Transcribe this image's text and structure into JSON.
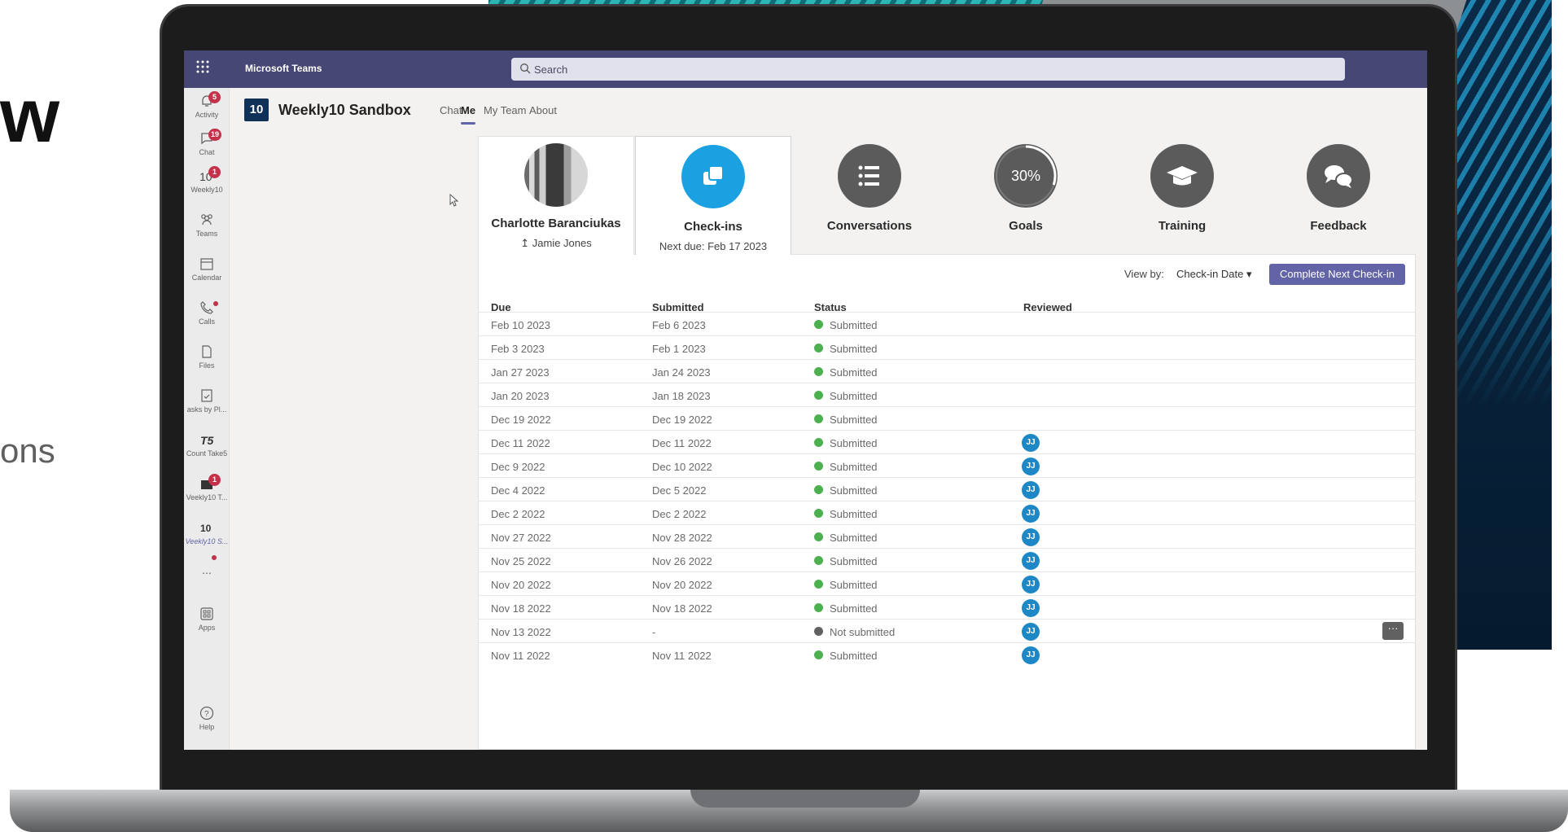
{
  "background": {
    "hero_letter": "w",
    "hero_subtext": "ons",
    "accent_dark": "#0b2b48",
    "accent_stripes": "#1f87b3"
  },
  "topbar": {
    "app_launcher_icon": "waffle-icon",
    "brand": "Microsoft Teams",
    "search_placeholder": "Search",
    "color": "#464775"
  },
  "rail": [
    {
      "label": "Activity",
      "icon": "bell-icon",
      "badge": "5"
    },
    {
      "label": "Chat",
      "icon": "chat-icon",
      "badge": "19"
    },
    {
      "label": "Weekly10",
      "icon": "weekly10-icon",
      "badge": "1"
    },
    {
      "label": "Teams",
      "icon": "teams-icon",
      "badge": ""
    },
    {
      "label": "Calendar",
      "icon": "calendar-icon",
      "badge": ""
    },
    {
      "label": "Calls",
      "icon": "phone-icon",
      "badge": ""
    },
    {
      "label": "Files",
      "icon": "file-icon",
      "badge": ""
    },
    {
      "label": "asks by Pl...",
      "icon": "tasks-icon",
      "badge": ""
    },
    {
      "label": "Count Take5",
      "icon": "take5-icon",
      "badge": ""
    },
    {
      "label": "Veekly10 T...",
      "icon": "weekly10-team-icon",
      "badge": "1"
    },
    {
      "label": "Veekly10 S...",
      "icon": "weekly10-sandbox-icon",
      "badge": ""
    },
    {
      "label": "...",
      "icon": "more-icon",
      "badge": ""
    },
    {
      "label": "Apps",
      "icon": "apps-icon",
      "badge": ""
    },
    {
      "label": "Help",
      "icon": "help-icon",
      "badge": ""
    }
  ],
  "app": {
    "logo": "10",
    "name": "Weekly10 Sandbox",
    "tabs": [
      "Chat",
      "Me",
      "My Team",
      "About"
    ],
    "active_tab": "Me"
  },
  "cards": {
    "profile": {
      "name": "Charlotte Baranciukas",
      "manager": "↥ Jamie Jones"
    },
    "checkins": {
      "title": "Check-ins",
      "sub": "Next due: Feb 17 2023",
      "color": "#1ba1e2"
    },
    "conversations": {
      "title": "Conversations",
      "color": "#5b5b5b"
    },
    "goals": {
      "title": "Goals",
      "progress_label": "30%",
      "progress": 0.3,
      "color": "#5b5b5b"
    },
    "training": {
      "title": "Training",
      "color": "#5b5b5b"
    },
    "feedback": {
      "title": "Feedback",
      "color": "#5b5b5b"
    }
  },
  "toolbar": {
    "view_by_label": "View by:",
    "view_by_value": "Check-in Date ▾",
    "cta_label": "Complete Next Check-in"
  },
  "table": {
    "headers": [
      "Due",
      "Submitted",
      "Status",
      "Reviewed"
    ],
    "rows": [
      {
        "due": "Feb 10 2023",
        "submitted": "Feb 6 2023",
        "status": "Submitted",
        "reviewed": ""
      },
      {
        "due": "Feb 3 2023",
        "submitted": "Feb 1 2023",
        "status": "Submitted",
        "reviewed": ""
      },
      {
        "due": "Jan 27 2023",
        "submitted": "Jan 24 2023",
        "status": "Submitted",
        "reviewed": ""
      },
      {
        "due": "Jan 20 2023",
        "submitted": "Jan 18 2023",
        "status": "Submitted",
        "reviewed": ""
      },
      {
        "due": "Dec 19 2022",
        "submitted": "Dec 19 2022",
        "status": "Submitted",
        "reviewed": ""
      },
      {
        "due": "Dec 11 2022",
        "submitted": "Dec 11 2022",
        "status": "Submitted",
        "reviewed": "JJ"
      },
      {
        "due": "Dec 9 2022",
        "submitted": "Dec 10 2022",
        "status": "Submitted",
        "reviewed": "JJ"
      },
      {
        "due": "Dec 4 2022",
        "submitted": "Dec 5 2022",
        "status": "Submitted",
        "reviewed": "JJ"
      },
      {
        "due": "Dec 2 2022",
        "submitted": "Dec 2 2022",
        "status": "Submitted",
        "reviewed": "JJ"
      },
      {
        "due": "Nov 27 2022",
        "submitted": "Nov 28 2022",
        "status": "Submitted",
        "reviewed": "JJ"
      },
      {
        "due": "Nov 25 2022",
        "submitted": "Nov 26 2022",
        "status": "Submitted",
        "reviewed": "JJ"
      },
      {
        "due": "Nov 20 2022",
        "submitted": "Nov 20 2022",
        "status": "Submitted",
        "reviewed": "JJ"
      },
      {
        "due": "Nov 18 2022",
        "submitted": "Nov 18 2022",
        "status": "Submitted",
        "reviewed": "JJ"
      },
      {
        "due": "Nov 13 2022",
        "submitted": "-",
        "status": "Not submitted",
        "reviewed": "JJ",
        "has_menu": true
      },
      {
        "due": "Nov 11 2022",
        "submitted": "Nov 11 2022",
        "status": "Submitted",
        "reviewed": "JJ"
      }
    ],
    "status_colors": {
      "Submitted": "#4caf50",
      "Not submitted": "#616161"
    }
  }
}
